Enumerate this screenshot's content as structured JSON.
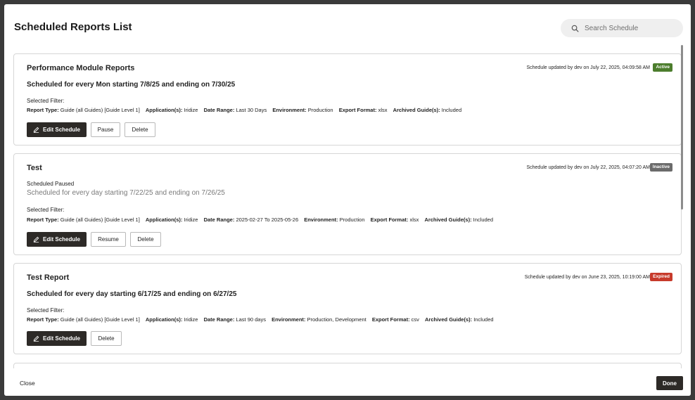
{
  "dialog": {
    "title": "Scheduled Reports List",
    "search": {
      "placeholder": "Search Schedule",
      "value": ""
    }
  },
  "cards": [
    {
      "name": "Performance Module Reports",
      "updated": "Schedule updated by dev on July 22, 2025, 04:09:58 AM",
      "status": "Active",
      "paused_label": "",
      "schedule": "Scheduled for every Mon starting 7/8/25 and ending on 7/30/25",
      "filter_label": "Selected Filter:",
      "filters": [
        {
          "k": "Report Type:",
          "v": "Guide (all Guides) [Guide Level 1]"
        },
        {
          "k": "Application(s):",
          "v": "Iridize"
        },
        {
          "k": "Date Range:",
          "v": "Last 30 Days"
        },
        {
          "k": "Environment:",
          "v": "Production"
        },
        {
          "k": "Export Format:",
          "v": "xlsx"
        },
        {
          "k": "Archived Guide(s):",
          "v": "Included"
        }
      ],
      "buttons": {
        "edit": "Edit Schedule",
        "toggle": "Pause",
        "delete": "Delete"
      }
    },
    {
      "name": "Test",
      "updated": "Schedule updated by dev on July 22, 2025, 04:07:20 AM",
      "status": "Inactive",
      "paused_label": "Scheduled Paused",
      "schedule": "Scheduled for every day starting 7/22/25 and ending on 7/26/25",
      "filter_label": "Selected Filter:",
      "filters": [
        {
          "k": "Report Type:",
          "v": "Guide (all Guides) [Guide Level 1]"
        },
        {
          "k": "Application(s):",
          "v": "Iridize"
        },
        {
          "k": "Date Range:",
          "v": "2025-02-27 To 2025-05-26"
        },
        {
          "k": "Environment:",
          "v": "Production"
        },
        {
          "k": "Export Format:",
          "v": "xlsx"
        },
        {
          "k": "Archived Guide(s):",
          "v": "Included"
        }
      ],
      "buttons": {
        "edit": "Edit Schedule",
        "toggle": "Resume",
        "delete": "Delete"
      }
    },
    {
      "name": "Test Report",
      "updated": "Schedule updated by dev on June 23, 2025, 10:19:00 AM",
      "status": "Expired",
      "paused_label": "",
      "schedule": "Scheduled for every day starting 6/17/25 and ending on 6/27/25",
      "filter_label": "Selected Filter:",
      "filters": [
        {
          "k": "Report Type:",
          "v": "Guide (all Guides) [Guide Level 1]"
        },
        {
          "k": "Application(s):",
          "v": "Iridize"
        },
        {
          "k": "Date Range:",
          "v": "Last 90 days"
        },
        {
          "k": "Environment:",
          "v": "Production, Development"
        },
        {
          "k": "Export Format:",
          "v": "csv"
        },
        {
          "k": "Archived Guide(s):",
          "v": "Included"
        }
      ],
      "buttons": {
        "edit": "Edit Schedule",
        "toggle": "",
        "delete": "Delete"
      }
    }
  ],
  "footer": {
    "close": "Close",
    "done": "Done"
  },
  "colors": {
    "active": "#4c7d2d",
    "inactive": "#6b6b6b",
    "expired": "#c73a2b",
    "primary_button": "#2d2a27"
  }
}
